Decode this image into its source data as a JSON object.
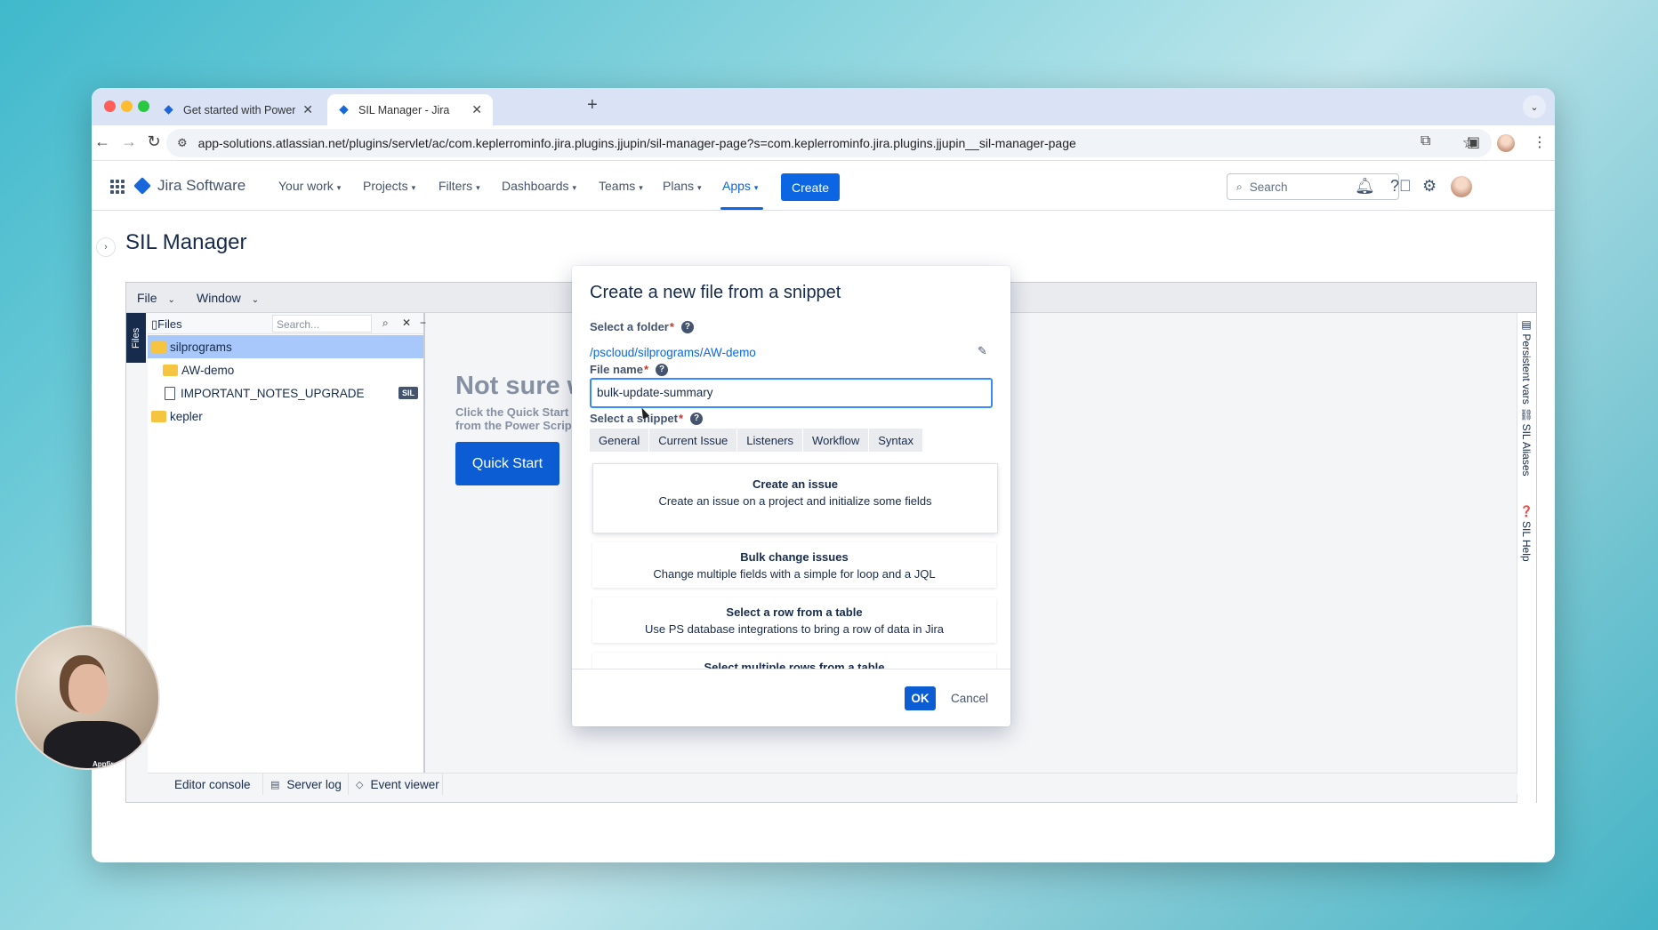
{
  "browser": {
    "tabs": [
      {
        "title": "Get started with PowerScript",
        "active": false
      },
      {
        "title": "SIL Manager - Jira",
        "active": true
      }
    ],
    "new_tab": "+",
    "url": "app-solutions.atlassian.net/plugins/servlet/ac/com.keplerrominfo.jira.plugins.jjupin/sil-manager-page?s=com.keplerrominfo.jira.plugins.jjupin__sil-manager-page"
  },
  "jira_nav": {
    "product": "Jira Software",
    "items": [
      "Your work",
      "Projects",
      "Filters",
      "Dashboards",
      "Teams",
      "Plans",
      "Apps"
    ],
    "active_item": "Apps",
    "create_label": "Create",
    "search_placeholder": "Search"
  },
  "page": {
    "title": "SIL Manager"
  },
  "ide": {
    "menus": [
      "File",
      "Window"
    ],
    "files_strip": "Files",
    "files_panel": {
      "title": "Files",
      "search_placeholder": "Search...",
      "tree": [
        {
          "name": "silprograms",
          "type": "folder",
          "selected": true
        },
        {
          "name": "AW-demo",
          "type": "folder"
        },
        {
          "name": "IMPORTANT_NOTES_UPGRADE",
          "type": "file",
          "badge": "SIL"
        },
        {
          "name": "kepler",
          "type": "folder"
        }
      ]
    },
    "editor": {
      "heading": "Not sure w",
      "sub_line1": "Click the Quick Start",
      "sub_line2": "from the Power Scrip",
      "quick_start": "Quick Start"
    },
    "right_tabs": [
      "Persistent vars",
      "SIL Aliases",
      "SIL Help"
    ],
    "bottom_tabs": [
      "Editor console",
      "Server log",
      "Event viewer"
    ]
  },
  "modal": {
    "title": "Create a new file from a snippet",
    "folder_label": "Select a folder",
    "folder_path": "/pscloud/silprograms/AW-demo",
    "filename_label": "File name",
    "filename_value": "bulk-update-summary",
    "snippet_label": "Select a snippet",
    "required_mark": "*",
    "help_mark": "?",
    "snippet_tabs": [
      "General",
      "Current Issue",
      "Listeners",
      "Workflow",
      "Syntax"
    ],
    "snippets": [
      {
        "title": "Create an issue",
        "desc": "Create an issue on a project and initialize some fields"
      },
      {
        "title": "Bulk change issues",
        "desc": "Change multiple fields with a simple for loop and a JQL"
      },
      {
        "title": "Select a row from a table",
        "desc": "Use PS database integrations to bring a row of data in Jira"
      },
      {
        "title": "Select multiple rows from a table",
        "desc": ""
      }
    ],
    "ok_label": "OK",
    "cancel_label": "Cancel"
  },
  "webcam": {
    "shirt_text": "Appfire"
  }
}
